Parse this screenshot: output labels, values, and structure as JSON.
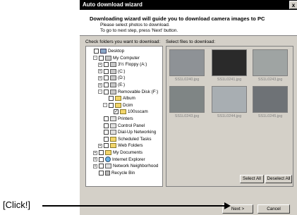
{
  "window": {
    "title": "Auto download wizard",
    "close_glyph": "x"
  },
  "header": {
    "title": "Downloading wizard will guide you to download camera images to PC",
    "subtitle1": "Please select photos to download.",
    "subtitle2": "To go to next step, press 'Next' button."
  },
  "left_panel": {
    "label": "Check folders you want to download:"
  },
  "right_panel": {
    "label": "Select files to download:"
  },
  "tree": [
    {
      "label": "Desktop",
      "icon": "desktop-icon",
      "expander": "",
      "checked": false
    },
    {
      "label": "My Computer",
      "icon": "computer-icon",
      "expander": "-",
      "checked": false
    },
    {
      "label": "3½ Floppy (A:)",
      "icon": "floppy-icon",
      "expander": "+",
      "checked": false
    },
    {
      "label": "(C:)",
      "icon": "drive-icon",
      "expander": "+",
      "checked": false
    },
    {
      "label": "(D:)",
      "icon": "drive-icon",
      "expander": "+",
      "checked": false
    },
    {
      "label": "(E:)",
      "icon": "cdrom-icon",
      "expander": "+",
      "checked": false
    },
    {
      "label": "Removable Disk (F:)",
      "icon": "drive-icon",
      "expander": "-",
      "checked": false
    },
    {
      "label": "Album",
      "icon": "folder-icon",
      "expander": "",
      "checked": false
    },
    {
      "label": "Dcim",
      "icon": "folder-icon",
      "expander": "-",
      "checked": false
    },
    {
      "label": "100sscam",
      "icon": "folder-icon",
      "expander": "",
      "checked": true
    },
    {
      "label": "Printers",
      "icon": "printer-icon",
      "expander": "",
      "checked": false
    },
    {
      "label": "Control Panel",
      "icon": "control-panel-icon",
      "expander": "",
      "checked": false
    },
    {
      "label": "Dial-Up Networking",
      "icon": "network-icon",
      "expander": "",
      "checked": false
    },
    {
      "label": "Scheduled Tasks",
      "icon": "tasks-icon",
      "expander": "",
      "checked": false
    },
    {
      "label": "Web Folders",
      "icon": "web-folder-icon",
      "expander": "+",
      "checked": false
    },
    {
      "label": "My Documents",
      "icon": "folder-icon",
      "expander": "+",
      "checked": false
    },
    {
      "label": "Internet Explorer",
      "icon": "globe-icon",
      "expander": "+",
      "checked": false
    },
    {
      "label": "Network Neighborhood",
      "icon": "network-icon",
      "expander": "+",
      "checked": false
    },
    {
      "label": "Recycle Bin",
      "icon": "recycle-bin-icon",
      "expander": "",
      "checked": false
    }
  ],
  "files": [
    {
      "name": "SS1L0240.jpg",
      "color": "#8e9296"
    },
    {
      "name": "SS1L0241.jpg",
      "color": "#2a2a2a"
    },
    {
      "name": "SS1L0243.jpg",
      "color": "#9fa4a3"
    },
    {
      "name": "SS1L0243.jpg",
      "color": "#7f8585"
    },
    {
      "name": "SS1L0244.jpg",
      "color": "#a8aeb2"
    },
    {
      "name": "SS1L0245.jpg",
      "color": "#6e7276"
    }
  ],
  "buttons": {
    "select_all": "Select All",
    "deselect_all": "Deselect All",
    "next": "Next >",
    "cancel": "Cancel"
  },
  "callout": {
    "text": "[Click!]"
  }
}
